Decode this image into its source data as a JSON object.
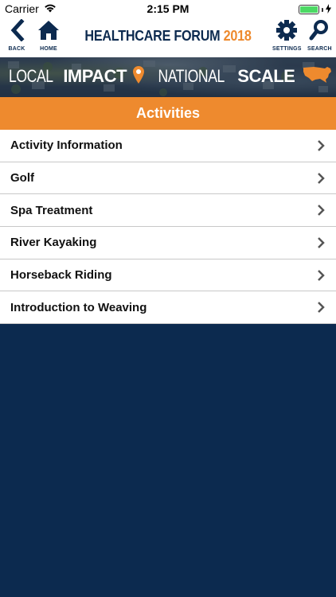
{
  "status_bar": {
    "carrier": "Carrier",
    "time": "2:15 PM",
    "battery_level": 1.0
  },
  "nav": {
    "back_label": "BACK",
    "home_label": "HOME",
    "title_main": "HEALTHCARE FORUM",
    "title_year": "2018",
    "settings_label": "SETTINGS",
    "search_label": "SEARCH"
  },
  "banner": {
    "word1": "LOCAL",
    "word2": "IMPACT",
    "word3": "NATIONAL",
    "word4": "SCALE"
  },
  "section": {
    "title": "Activities"
  },
  "list": {
    "items": [
      {
        "label": "Activity Information"
      },
      {
        "label": "Golf"
      },
      {
        "label": "Spa Treatment"
      },
      {
        "label": "River Kayaking"
      },
      {
        "label": "Horseback Riding"
      },
      {
        "label": "Introduction to Weaving"
      }
    ]
  },
  "colors": {
    "navy": "#0c2a4f",
    "orange": "#ee8a2e",
    "battery_green": "#4cd964"
  },
  "icons": {
    "back": "chevron-left-icon",
    "home": "home-icon",
    "settings": "gear-icon",
    "search": "search-icon",
    "wifi": "wifi-icon",
    "battery": "battery-icon",
    "charging": "lightning-icon",
    "pin": "location-pin-icon",
    "map": "usa-map-icon",
    "row": "chevron-right-icon"
  }
}
